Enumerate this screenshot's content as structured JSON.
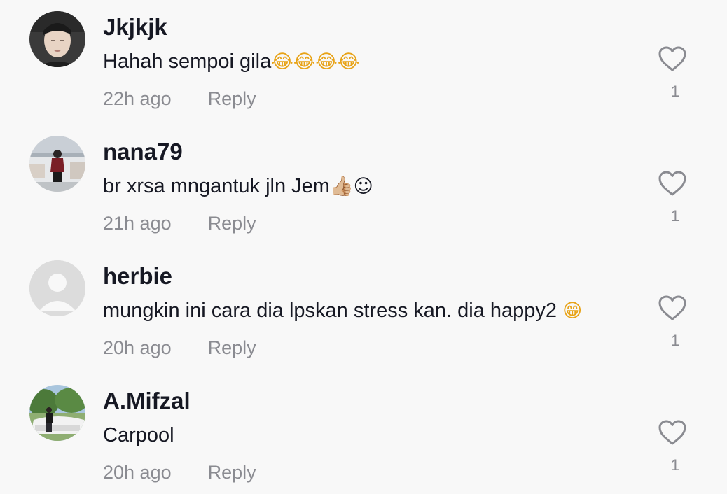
{
  "comments": [
    {
      "username": "Jkjkjk",
      "text": "Hahah sempoi gila",
      "emojis": "😂😂😂😂",
      "time": "22h ago",
      "reply_label": "Reply",
      "likes": "1",
      "avatar_icon": "profile-photo-man"
    },
    {
      "username": "nana79",
      "text": "br xrsa mngantuk jln Jem",
      "emojis": "👍🏼",
      "emojis_after": "☺",
      "time": "21h ago",
      "reply_label": "Reply",
      "likes": "1",
      "avatar_icon": "profile-photo-woman-standing"
    },
    {
      "username": "herbie",
      "text": "mungkin ini cara dia lpskan stress kan. dia happy2 ",
      "emojis": "😁",
      "time": "20h ago",
      "reply_label": "Reply",
      "likes": "1",
      "avatar_icon": "default-avatar-icon"
    },
    {
      "username": "A.Mifzal",
      "text": "Carpool",
      "emojis": "",
      "time": "20h ago",
      "reply_label": "Reply",
      "likes": "1",
      "avatar_icon": "profile-photo-man-car"
    }
  ],
  "colors": {
    "background": "#f8f8f8",
    "username": "#161823",
    "meta": "#8a8b91",
    "heart_outline": "#8a8b91"
  }
}
